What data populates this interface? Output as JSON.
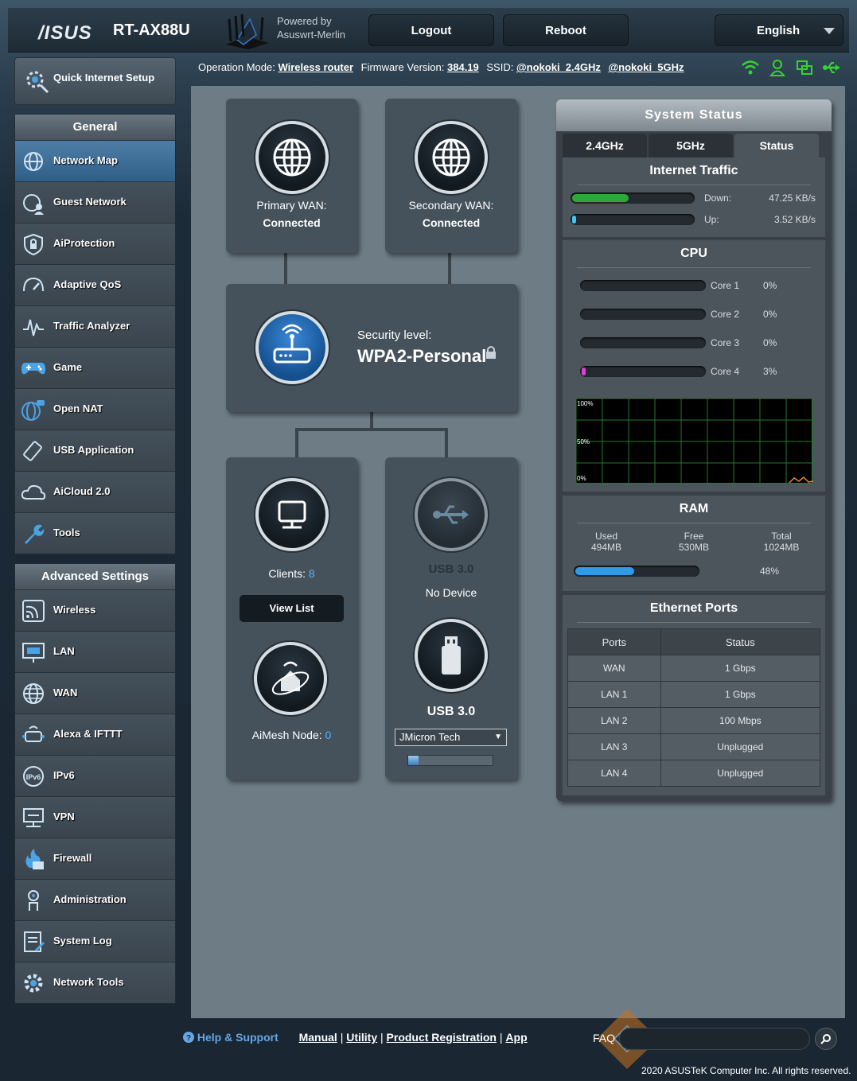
{
  "header": {
    "brand": "/ISUS",
    "model": "RT-AX88U",
    "powered_by_line1": "Powered by",
    "powered_by_line2": "Asuswrt-Merlin",
    "logout": "Logout",
    "reboot": "Reboot",
    "language": "English"
  },
  "opline": {
    "mode_label": "Operation Mode:",
    "mode_value": "Wireless router",
    "fw_label": "Firmware Version:",
    "fw_value": "384.19",
    "ssid_label": "SSID:",
    "ssid_1": "@nokoki_2.4GHz",
    "ssid_2": "@nokoki_5GHz"
  },
  "status_icons": [
    "wifi-icon",
    "user-icon",
    "network-icon",
    "usb-icon"
  ],
  "sidebar": {
    "quick_setup": "Quick Internet Setup",
    "general_title": "General",
    "general": [
      {
        "label": "Network Map",
        "icon": "network-map-icon",
        "active": true
      },
      {
        "label": "Guest Network",
        "icon": "guest-network-icon"
      },
      {
        "label": "AiProtection",
        "icon": "shield-icon"
      },
      {
        "label": "Adaptive QoS",
        "icon": "gauge-icon"
      },
      {
        "label": "Traffic Analyzer",
        "icon": "analyzer-icon"
      },
      {
        "label": "Game",
        "icon": "gamepad-icon"
      },
      {
        "label": "Open NAT",
        "icon": "open-nat-icon"
      },
      {
        "label": "USB Application",
        "icon": "usb-app-icon"
      },
      {
        "label": "AiCloud 2.0",
        "icon": "cloud-icon"
      },
      {
        "label": "Tools",
        "icon": "wrench-icon"
      }
    ],
    "advanced_title": "Advanced Settings",
    "advanced": [
      {
        "label": "Wireless",
        "icon": "wireless-icon"
      },
      {
        "label": "LAN",
        "icon": "lan-icon"
      },
      {
        "label": "WAN",
        "icon": "globe-icon"
      },
      {
        "label": "Alexa & IFTTT",
        "icon": "alexa-icon"
      },
      {
        "label": "IPv6",
        "icon": "ipv6-icon"
      },
      {
        "label": "VPN",
        "icon": "vpn-icon"
      },
      {
        "label": "Firewall",
        "icon": "firewall-icon"
      },
      {
        "label": "Administration",
        "icon": "admin-icon"
      },
      {
        "label": "System Log",
        "icon": "log-icon"
      },
      {
        "label": "Network Tools",
        "icon": "gear-icon"
      }
    ]
  },
  "map": {
    "primary_wan_label": "Primary WAN:",
    "primary_wan_status": "Connected",
    "secondary_wan_label": "Secondary WAN:",
    "secondary_wan_status": "Connected",
    "security_label": "Security level:",
    "security_value": "WPA2-Personal",
    "clients_label": "Clients:",
    "clients_count": "8",
    "view_list": "View List",
    "aimesh_label": "AiMesh Node:",
    "aimesh_count": "0",
    "usb1_title": "USB 3.0",
    "usb1_status": "No Device",
    "usb2_title": "USB 3.0",
    "usb2_device": "JMicron Tech",
    "usb2_usage": 0.12
  },
  "system_status": {
    "title": "System Status",
    "tabs": [
      "2.4GHz",
      "5GHz",
      "Status"
    ],
    "active_tab": "Status",
    "internet_traffic_title": "Internet Traffic",
    "down_label": "Down:",
    "down_value": "47.25 KB/s",
    "down_level": 0.47,
    "up_label": "Up:",
    "up_value": "3.52 KB/s",
    "up_level": 0.03,
    "cpu_title": "CPU",
    "cores": [
      {
        "label": "Core 1",
        "value": "0%",
        "level": 0
      },
      {
        "label": "Core 2",
        "value": "0%",
        "level": 0
      },
      {
        "label": "Core 3",
        "value": "0%",
        "level": 0
      },
      {
        "label": "Core 4",
        "value": "3%",
        "level": 0.03
      }
    ],
    "graph_labels": [
      "100%",
      "50%",
      "0%"
    ],
    "ram_title": "RAM",
    "ram_used_label": "Used",
    "ram_used": "494MB",
    "ram_free_label": "Free",
    "ram_free": "530MB",
    "ram_total_label": "Total",
    "ram_total": "1024MB",
    "ram_percent": "48%",
    "ram_level": 0.48,
    "eth_title": "Ethernet Ports",
    "eth_headers": [
      "Ports",
      "Status"
    ],
    "eth_rows": [
      [
        "WAN",
        "1 Gbps"
      ],
      [
        "LAN 1",
        "1 Gbps"
      ],
      [
        "LAN 2",
        "100 Mbps"
      ],
      [
        "LAN 3",
        "Unplugged"
      ],
      [
        "LAN 4",
        "Unplugged"
      ]
    ]
  },
  "footer": {
    "help": "Help & Support",
    "manual": "Manual",
    "utility": "Utility",
    "registration": "Product Registration",
    "app": "App",
    "sep": "|",
    "faq": "FAQ",
    "copyright": "2020 ASUSTeK Computer Inc. All rights reserved."
  },
  "colors": {
    "accent_blue": "#2d9be8",
    "down_green": "#2fa836",
    "up_cyan": "#3ec7f2",
    "core4_magenta": "#e040d8",
    "status_green": "#34d62c",
    "clients_blue": "#52b4ff"
  }
}
